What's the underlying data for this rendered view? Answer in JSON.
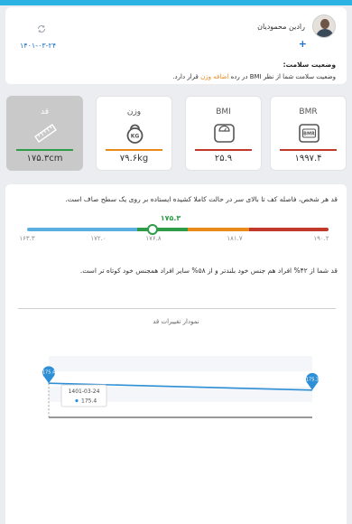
{
  "profile": {
    "name": "رادین محمودیان",
    "date": "۱۴۰۱-۰۳-۲۴",
    "status_title": "وضعیت سلامت:",
    "status_text_before": "وضعیت سلامت شما از نظر BMI در رده ",
    "status_highlight": "اضافه وزن",
    "status_text_after": " قرار دارد."
  },
  "metrics": [
    {
      "label": "BMR",
      "value": "۱۹۹۷.۴",
      "color": "#c0392b",
      "icon": "bmr-scale-icon"
    },
    {
      "label": "BMI",
      "value": "۲۵.۹",
      "color": "#c0392b",
      "icon": "bathroom-scale-icon"
    },
    {
      "label": "وزن",
      "value": "۷۹.۶kg",
      "color": "#e98a1a",
      "icon": "kettlebell-icon"
    },
    {
      "label": "قد",
      "value": "۱۷۵.۳cm",
      "color": "#2e9c48",
      "icon": "ruler-icon"
    }
  ],
  "height_detail": {
    "description": "قد هر شخص، فاصله کف تا بالای سر در حالت کاملا کشیده ایستاده بر روی یک سطح صاف است.",
    "current": "۱۷۵.۳",
    "ticks": [
      "۱۶۳.۳",
      "۱۷۲.۰",
      "۱۷۶.۸",
      "۱۸۱.۷",
      "۱۹۰.۲"
    ],
    "segment_colors": [
      "#5aaee0",
      "#2e9c48",
      "#e98a1a",
      "#c0392b"
    ],
    "compare_text": "قد شما از ۴۲% افراد هم جنس خود بلندتر و از ۵۸% سایر افراد همجنس خود کوتاه تر است."
  },
  "chart_data": {
    "type": "line",
    "title": "نمودار تغییرات قد",
    "series": [
      {
        "values": [
          175.4,
          175.3
        ]
      }
    ],
    "point_labels": [
      "175.4",
      "175.3"
    ],
    "ylim": [
      174.9,
      175.8
    ],
    "tooltip": {
      "date": "1401-03-24",
      "value": "175.4"
    },
    "color": "#2d8fd5"
  }
}
